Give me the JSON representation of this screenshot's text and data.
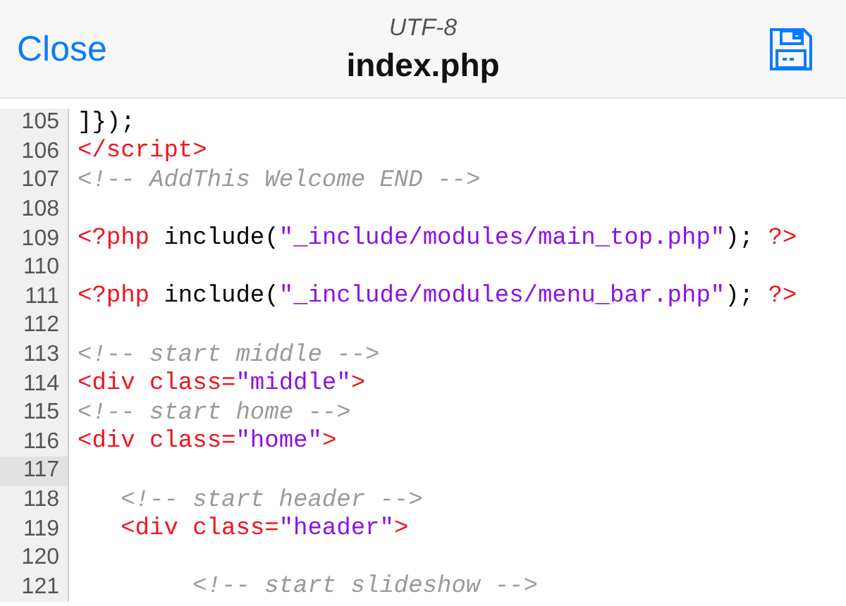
{
  "header": {
    "encoding": "UTF-8",
    "title": "index.php",
    "close": "Close"
  },
  "lines": [
    {
      "number": "105",
      "current": false,
      "tokens": [
        {
          "kind": "plain",
          "text": "]});"
        }
      ]
    },
    {
      "number": "106",
      "current": false,
      "tokens": [
        {
          "kind": "tag",
          "text": "</script>"
        }
      ]
    },
    {
      "number": "107",
      "current": false,
      "tokens": [
        {
          "kind": "comment",
          "text": "<!-- AddThis Welcome END -->"
        }
      ]
    },
    {
      "number": "108",
      "current": false
    },
    {
      "number": "109",
      "current": false,
      "tokens": [
        {
          "kind": "tag",
          "text": "<?php"
        },
        {
          "kind": "plain",
          "text": " include("
        },
        {
          "kind": "string",
          "text": "\"_include/modules/main_top.php\""
        },
        {
          "kind": "plain",
          "text": "); "
        },
        {
          "kind": "tag",
          "text": "?>"
        }
      ]
    },
    {
      "number": "110",
      "current": false
    },
    {
      "number": "111",
      "current": false,
      "tokens": [
        {
          "kind": "tag",
          "text": "<?php"
        },
        {
          "kind": "plain",
          "text": " include("
        },
        {
          "kind": "string",
          "text": "\"_include/modules/menu_bar.php\""
        },
        {
          "kind": "plain",
          "text": "); "
        },
        {
          "kind": "tag",
          "text": "?>"
        }
      ]
    },
    {
      "number": "112",
      "current": false
    },
    {
      "number": "113",
      "current": false,
      "tokens": [
        {
          "kind": "comment",
          "text": "<!-- start middle -->"
        }
      ]
    },
    {
      "number": "114",
      "current": false,
      "tokens": [
        {
          "kind": "tag",
          "text": "<div class="
        },
        {
          "kind": "string",
          "text": "\"middle\""
        },
        {
          "kind": "tag",
          "text": ">"
        }
      ]
    },
    {
      "number": "115",
      "current": false,
      "tokens": [
        {
          "kind": "comment",
          "text": "<!-- start home -->"
        }
      ]
    },
    {
      "number": "116",
      "current": false,
      "tokens": [
        {
          "kind": "tag",
          "text": "<div class="
        },
        {
          "kind": "string",
          "text": "\"home\""
        },
        {
          "kind": "tag",
          "text": ">"
        }
      ],
      "children": [
        {
          "number": "117",
          "current": true
        },
        {
          "number": "118",
          "current": false,
          "tokens": [
            {
              "kind": "comment",
              "text": "<!-- start header -->"
            }
          ]
        },
        {
          "number": "119",
          "current": false,
          "tokens": [
            {
              "kind": "tag",
              "text": "<div class="
            },
            {
              "kind": "string",
              "text": "\"header\""
            },
            {
              "kind": "tag",
              "text": ">"
            }
          ],
          "children": [
            {
              "number": "120",
              "current": false
            },
            {
              "number": "121",
              "current": false,
              "tokens": [
                {
                  "kind": "comment",
                  "text": "<!-- start slideshow -->"
                }
              ]
            }
          ]
        }
      ]
    }
  ]
}
